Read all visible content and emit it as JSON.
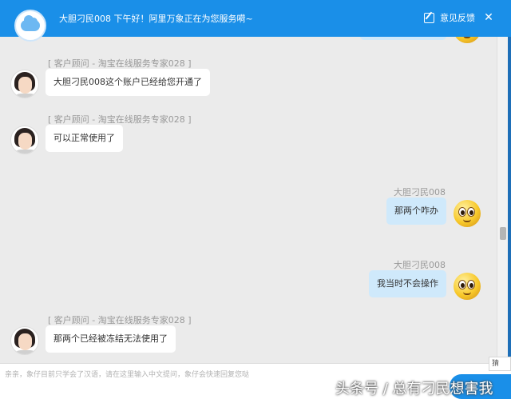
{
  "header": {
    "greeting": "大胆刁民008  下午好！阿里万象正在为您服务嗬~",
    "feedback_label": "意见反馈",
    "close_glyph": "✕"
  },
  "messages": [
    {
      "from": "agent",
      "sender": "[ 客户顾问  -  淘宝在线服务专家028 ]",
      "text": "大胆刁民008这个账户已经给您开通了"
    },
    {
      "from": "agent",
      "sender": "[ 客户顾问  -  淘宝在线服务专家028 ]",
      "text": "可以正常使用了"
    },
    {
      "from": "user",
      "sender": "大胆刁民008",
      "text": "那两个咋办"
    },
    {
      "from": "user",
      "sender": "大胆刁民008",
      "text": "我当时不会操作"
    },
    {
      "from": "agent",
      "sender": "[ 客户顾问  -  淘宝在线服务专家028 ]",
      "text": "那两个已经被冻结无法使用了"
    }
  ],
  "input": {
    "placeholder": "亲亲，象仔目前只学会了汉语，请在这里输入中文提问，象仔会快速回复您哒"
  },
  "side_widget": {
    "label": "猜"
  },
  "watermark": "头条号 / 总有刁民想害我",
  "colors": {
    "brand": "#1a8fe8",
    "user_bubble": "#cfe9fb",
    "agent_bubble": "#ffffff"
  }
}
